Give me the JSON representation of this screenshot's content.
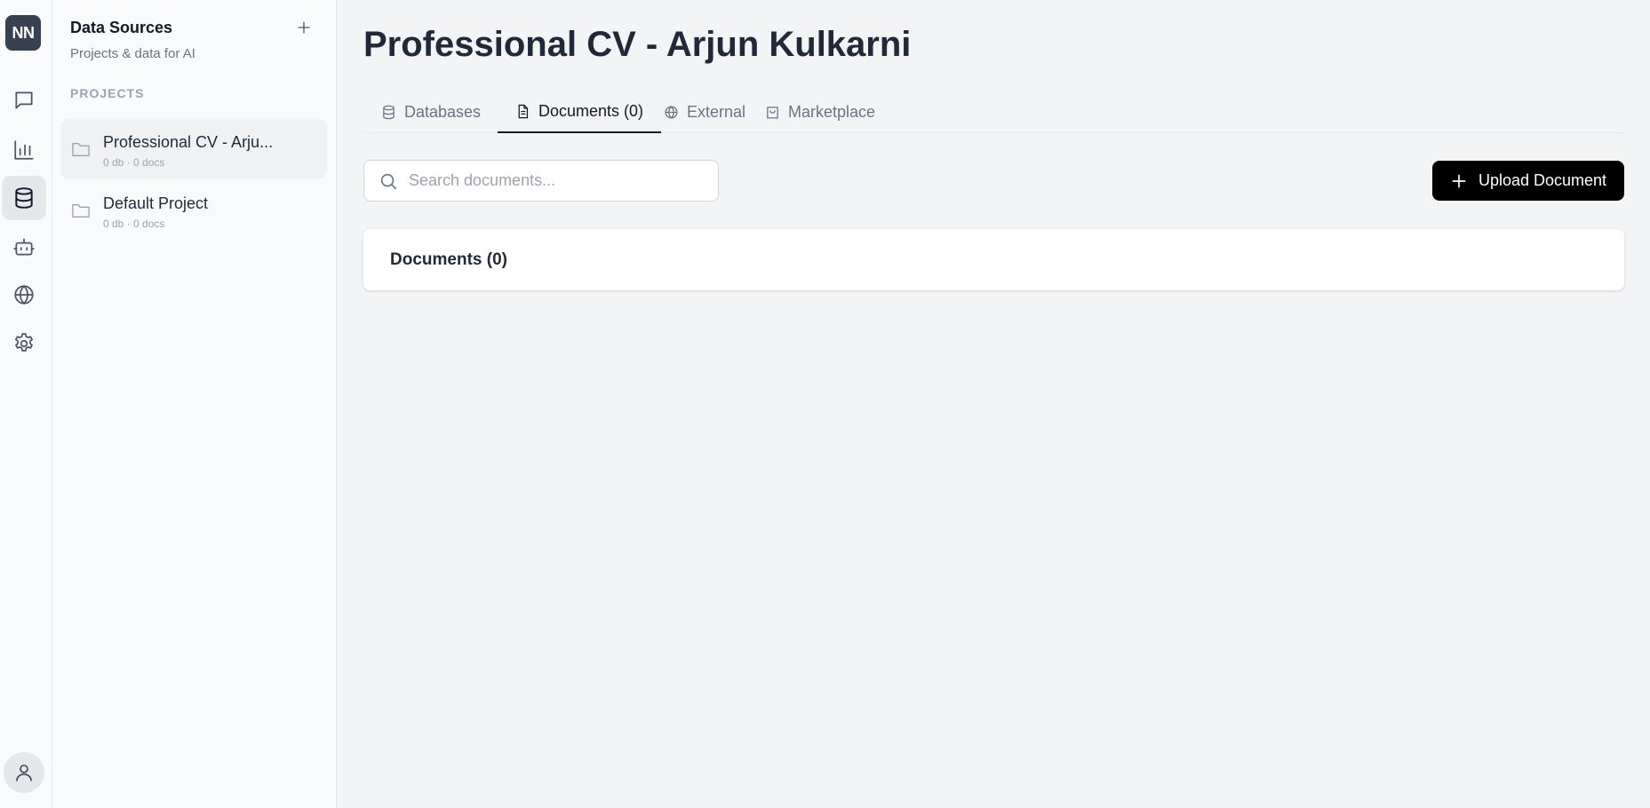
{
  "rail": {
    "logo": "NN",
    "items": [
      {
        "icon": "chat-icon",
        "active": false
      },
      {
        "icon": "bar-chart-icon",
        "active": false
      },
      {
        "icon": "database-icon",
        "active": true
      },
      {
        "icon": "bot-icon",
        "active": false
      },
      {
        "icon": "globe-icon",
        "active": false
      },
      {
        "icon": "gear-icon",
        "active": false
      }
    ],
    "user_icon": "user-icon"
  },
  "sidebar": {
    "title": "Data Sources",
    "subtitle": "Projects & data for AI",
    "section_label": "PROJECTS",
    "projects": [
      {
        "name": "Professional CV - Arju...",
        "meta": "0 db · 0 docs",
        "active": true
      },
      {
        "name": "Default Project",
        "meta": "0 db · 0 docs",
        "active": false
      }
    ]
  },
  "main": {
    "title": "Professional CV - Arjun Kulkarni",
    "tabs": [
      {
        "label": "Databases",
        "icon": "database-icon",
        "active": false
      },
      {
        "label": "Documents (0)",
        "icon": "document-icon",
        "active": true
      },
      {
        "label": "External",
        "icon": "globe-icon",
        "active": false
      },
      {
        "label": "Marketplace",
        "icon": "shopping-bag-icon",
        "active": false
      }
    ],
    "search": {
      "placeholder": "Search documents...",
      "value": ""
    },
    "upload_label": "Upload Document",
    "documents_card": {
      "title": "Documents (0)"
    }
  },
  "colors": {
    "background": "#f3f4f6",
    "sidebar_bg": "#f9fafb",
    "accent": "#000000",
    "text": "#1f2937",
    "muted": "#6b7280"
  }
}
